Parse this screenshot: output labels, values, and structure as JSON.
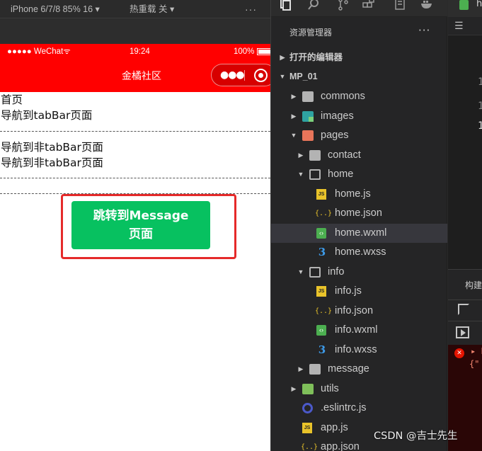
{
  "simulator": {
    "device": "iPhone 6/7/8 85% 16 ▾",
    "hot_reload": "热重载 关 ▾",
    "more": "···",
    "status_bar": {
      "carrier": "●●●●● WeChat",
      "wifi_glyph": "ᯤ",
      "time": "19:24",
      "battery": "100%"
    },
    "nav_title": "金橘社区",
    "page": {
      "lines": [
        "首页",
        "导航到tabBar页面",
        "导航到非tabBar页面",
        "导航到非tabBar页面"
      ],
      "button_line1": "跳转到Message",
      "button_line2": "页面"
    },
    "colors": {
      "nav_bg": "#ff0000",
      "button_bg": "#07c160",
      "frame": "#e52a2a"
    }
  },
  "explorer": {
    "title": "资源管理器",
    "more": "···",
    "activity_icons": [
      "files-icon",
      "search-icon",
      "source-control-icon",
      "extensions-icon",
      "remote-icon",
      "docker-icon"
    ],
    "sections": {
      "open_editors": "打开的编辑器",
      "project": "MP_01"
    },
    "tree": {
      "commons": "commons",
      "images": "images",
      "pages": "pages",
      "contact": "contact",
      "home": "home",
      "home_js": "home.js",
      "home_json": "home.json",
      "home_wxml": "home.wxml",
      "home_wxss": "home.wxss",
      "info": "info",
      "info_js": "info.js",
      "info_json": "info.json",
      "info_wxml": "info.wxml",
      "info_wxss": "info.wxss",
      "message": "message",
      "utils": "utils",
      "eslintrc": ".eslintrc.js",
      "app_js": "app.js",
      "app_json": "app.json"
    },
    "selected": "home.wxml"
  },
  "editor": {
    "tab_label": "h",
    "gutter": [
      "1",
      "1",
      "1"
    ],
    "panel_tab": "构建",
    "console": {
      "line1": "▸ E",
      "line2": "{\""
    }
  },
  "watermark": "CSDN @吉士先生"
}
